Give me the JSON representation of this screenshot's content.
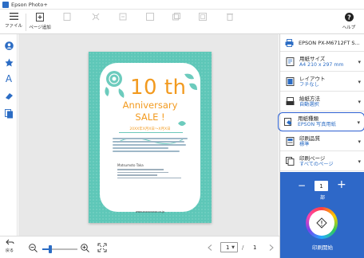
{
  "window": {
    "title": "Epson Photo+"
  },
  "toolbar": {
    "file_label": "ファイル",
    "add_page_label": "ページ追加",
    "help_label": "ヘルプ"
  },
  "document": {
    "headline_number": "10 th",
    "headline_anniversary": "Anniversary",
    "headline_sale": "SALE !",
    "date_text": "20XX年X月X日～X月X日",
    "contact_name": "Matsumoto Taka",
    "url_text": "www.xxxxxxxxxx.co.jp"
  },
  "statusbar": {
    "back_label": "戻る",
    "zoom_level_fraction": 0.2,
    "current_page": "1",
    "page_separator": "/",
    "total_pages": "1"
  },
  "panel": {
    "printer_name": "EPSON PX-M6712FT S...",
    "settings": [
      {
        "key": "用紙サイズ",
        "value": "A4 210 x 297 mm",
        "icon": "paper-size-icon"
      },
      {
        "key": "レイアウト",
        "value": "フチなし",
        "icon": "layout-icon"
      },
      {
        "key": "給紙方法",
        "value": "自動選択",
        "icon": "paper-feed-icon"
      },
      {
        "key": "用紙種類",
        "value": "EPSON 写真用紙",
        "icon": "paper-type-icon"
      },
      {
        "key": "印刷品質",
        "value": "標準",
        "icon": "print-quality-icon"
      },
      {
        "key": "印刷ページ",
        "value": "すべてのページ",
        "icon": "print-pages-icon"
      }
    ],
    "copies": "1",
    "copies_unit": "部",
    "print_label": "印刷開始"
  },
  "colors": {
    "accent": "#2e68c8",
    "highlight_border": "#2b5fd0",
    "paper_teal": "#5ec7b8",
    "headline_orange": "#f29a1f"
  }
}
